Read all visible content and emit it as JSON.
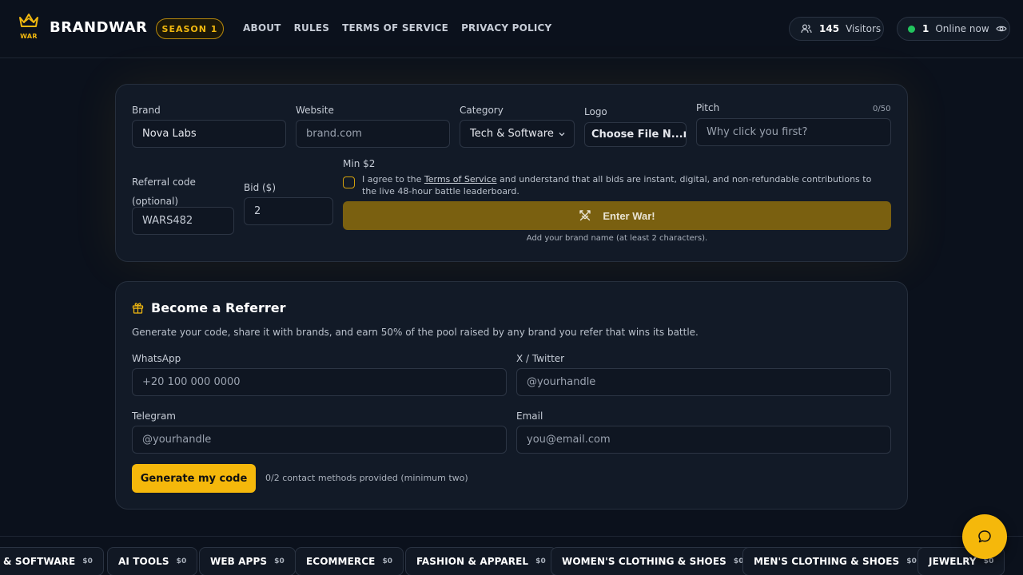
{
  "header": {
    "logo_text": "WAR",
    "brand": "BRANDWAR",
    "season": "SEASON 1",
    "nav": [
      "ABOUT",
      "RULES",
      "TERMS OF SERVICE",
      "PRIVACY POLICY"
    ],
    "visitors_count": "145",
    "visitors_label": "Visitors",
    "online_count": "1",
    "online_label": "Online now"
  },
  "entry_form": {
    "brand_label": "Brand",
    "brand_value": "Nova Labs",
    "website_label": "Website",
    "website_placeholder": "brand.com",
    "category_label": "Category",
    "category_value": "Tech & Software",
    "logo_label": "Logo",
    "logo_button": "Choose File N...n",
    "pitch_label": "Pitch",
    "pitch_counter": "0/50",
    "pitch_placeholder": "Why click you first?",
    "referral_label": "Referral code (optional)",
    "referral_value": "WARS482",
    "bid_label": "Bid ($)",
    "bid_value": "2",
    "min_bid": "Min $2",
    "agree_prefix": "I agree to the ",
    "agree_link": "Terms of Service",
    "agree_suffix": " and understand that all bids are instant, digital, and non-refundable contributions to the live 48-hour battle leaderboard.",
    "submit_label": "Enter War!",
    "hint": "Add your brand name (at least 2 characters)."
  },
  "referrer": {
    "title": "Become a Referrer",
    "description": "Generate your code, share it with brands, and earn 50% of the pool raised by any brand you refer that wins its battle.",
    "whatsapp_label": "WhatsApp",
    "whatsapp_placeholder": "+20 100 000 0000",
    "twitter_label": "X / Twitter",
    "twitter_placeholder": "@yourhandle",
    "telegram_label": "Telegram",
    "telegram_placeholder": "@yourhandle",
    "email_label": "Email",
    "email_placeholder": "you@email.com",
    "button": "Generate my code",
    "status": "0/2 contact methods provided (minimum two)"
  },
  "ticker": [
    {
      "name": "& SOFTWARE",
      "amount": "$0"
    },
    {
      "name": "AI TOOLS",
      "amount": "$0"
    },
    {
      "name": "WEB APPS",
      "amount": "$0"
    },
    {
      "name": "ECOMMERCE",
      "amount": "$0"
    },
    {
      "name": "FASHION & APPAREL",
      "amount": "$0"
    },
    {
      "name": "WOMEN'S CLOTHING & SHOES",
      "amount": "$0"
    },
    {
      "name": "MEN'S CLOTHING & SHOES",
      "amount": "$0"
    },
    {
      "name": "JEWELRY",
      "amount": "$0"
    }
  ],
  "colors": {
    "accent": "#f5b80b",
    "background": "#0b111c",
    "card": "#121a27",
    "online": "#22c55e"
  }
}
